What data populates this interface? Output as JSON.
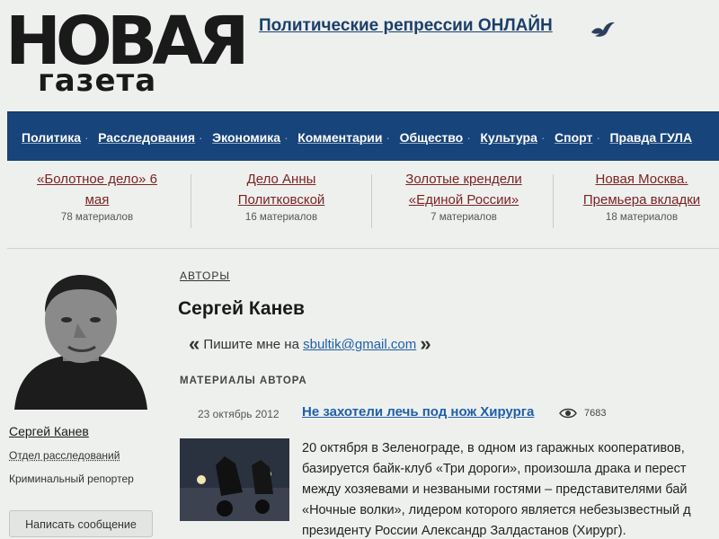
{
  "header": {
    "logo_top": "НОВАЯ",
    "logo_bottom": "газета",
    "promo_link": "Политические репрессии ОНЛАЙН"
  },
  "nav": {
    "items": [
      {
        "label": "Политика"
      },
      {
        "label": "Расследования"
      },
      {
        "label": "Экономика"
      },
      {
        "label": "Комментарии"
      },
      {
        "label": "Общество"
      },
      {
        "label": "Культура"
      },
      {
        "label": "Спорт"
      },
      {
        "label": "Правда ГУЛА"
      }
    ],
    "bg_color": "#17447a"
  },
  "topics": [
    {
      "title_line1": "«Болотное дело» 6",
      "title_line2": "мая",
      "count": "78 материалов"
    },
    {
      "title_line1": "Дело Анны",
      "title_line2": "Политковской",
      "count": "16 материалов"
    },
    {
      "title_line1": "Золотые крендели",
      "title_line2": "«Единой России»",
      "count": "7 материалов"
    },
    {
      "title_line1": "Новая Москва.",
      "title_line2": "Премьера вкладки",
      "count": "18 материалов"
    }
  ],
  "sidebar": {
    "name": "Сергей Канев",
    "department": "Отдел расследований",
    "role": "Криминальный репортер",
    "message_button": "Написать сообщение"
  },
  "main": {
    "section_label": "АВТОРЫ",
    "author_name": "Сергей Канев",
    "contact_prefix": "Пишите мне на",
    "email": "sbultik@gmail.com",
    "quote_open": "«",
    "quote_close": "»",
    "materials_label": "МАТЕРИАЛЫ АВТОРА",
    "article": {
      "date": "23 октябрь 2012",
      "title": "Не захотели лечь под нож Хирурга",
      "views": "7683",
      "lines": [
        "20 октября в Зеленограде, в одном из гаражных кооперативов,",
        "базируется байк-клуб «Три дороги», произошла драка и перест",
        "между хозяевами и незваными гостями – представителями бай",
        "«Ночные волки», лидером которого является небезызвестный д",
        "президенту России Александр Залдастанов (Хирург)."
      ]
    }
  },
  "icons": {
    "promo": "bird-icon",
    "views": "eye-icon"
  }
}
